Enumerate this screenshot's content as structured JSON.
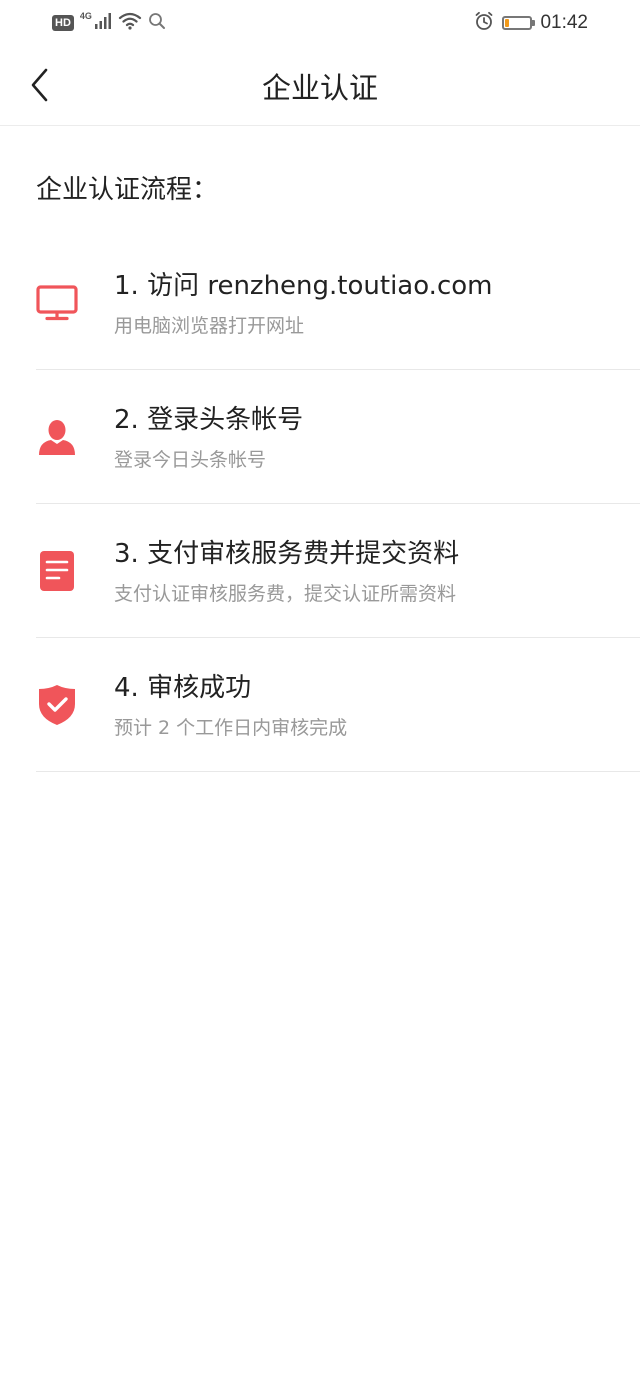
{
  "status_bar": {
    "hd_badge": "HD",
    "network_type": "4G",
    "time": "01:42",
    "battery_level": 0.15
  },
  "nav": {
    "title": "企业认证"
  },
  "section": {
    "title": "企业认证流程："
  },
  "steps": [
    {
      "icon": "monitor-icon",
      "title": "1. 访问 renzheng.toutiao.com",
      "desc": "用电脑浏览器打开网址"
    },
    {
      "icon": "user-icon",
      "title": "2. 登录头条帐号",
      "desc": "登录今日头条帐号"
    },
    {
      "icon": "document-icon",
      "title": "3. 支付审核服务费并提交资料",
      "desc": "支付认证审核服务费，提交认证所需资料"
    },
    {
      "icon": "shield-check-icon",
      "title": "4. 审核成功",
      "desc": "预计 2 个工作日内审核完成"
    }
  ],
  "colors": {
    "accent": "#f0555a",
    "text_primary": "#222222",
    "text_secondary": "#999999",
    "divider": "#e8e8e8"
  }
}
